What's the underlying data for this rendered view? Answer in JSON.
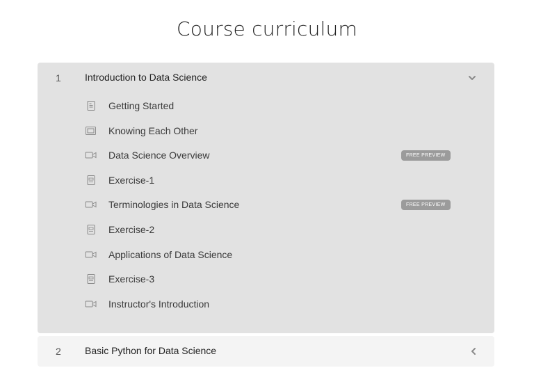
{
  "page": {
    "title": "Course curriculum"
  },
  "curriculum": {
    "sections": [
      {
        "number": "1",
        "title": "Introduction to Data Science",
        "expanded": true,
        "lessons": [
          {
            "label": "Getting Started",
            "icon": "document-icon",
            "badge": ""
          },
          {
            "label": "Knowing Each Other",
            "icon": "slides-icon",
            "badge": ""
          },
          {
            "label": "Data Science Overview",
            "icon": "video-icon",
            "badge": "FREE PREVIEW"
          },
          {
            "label": "Exercise-1",
            "icon": "code-file-icon",
            "badge": ""
          },
          {
            "label": "Terminologies in Data Science",
            "icon": "video-icon",
            "badge": "FREE PREVIEW"
          },
          {
            "label": "Exercise-2",
            "icon": "code-file-icon",
            "badge": ""
          },
          {
            "label": "Applications of Data Science",
            "icon": "video-icon",
            "badge": ""
          },
          {
            "label": "Exercise-3",
            "icon": "code-file-icon",
            "badge": ""
          },
          {
            "label": "Instructor's Introduction",
            "icon": "video-icon",
            "badge": ""
          }
        ]
      },
      {
        "number": "2",
        "title": "Basic Python for Data Science",
        "expanded": false,
        "lessons": []
      }
    ]
  },
  "colors": {
    "open_section_bg": "#e2e2e2",
    "closed_section_bg": "#f4f4f4",
    "badge_bg": "#9b9b9b",
    "badge_text": "#ffffff",
    "icon_stroke": "#8a8a8a"
  }
}
